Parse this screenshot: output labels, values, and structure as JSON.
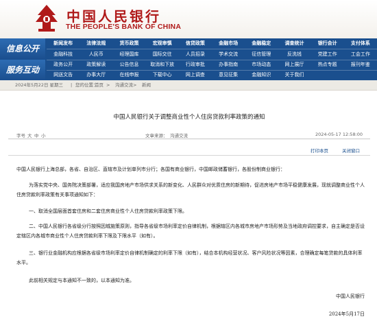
{
  "header": {
    "name_cn": "中国人民银行",
    "name_en": "THE PEOPLE'S BANK OF CHINA",
    "brand_color": "#b01a1a"
  },
  "nav": {
    "bg_color": "#1a4f8e",
    "label_1": "信息公开",
    "label_2": "服务互动",
    "row1": [
      "新闻发布",
      "法律法规",
      "货币政策",
      "宏观审慎",
      "信贷政策",
      "金融市场",
      "金融稳定",
      "调查统计",
      "银行会计",
      "支付体系"
    ],
    "row2": [
      "金融科技",
      "人民币",
      "经理国库",
      "国际交往",
      "人员招录",
      "学术交流",
      "征信管理",
      "反洗钱",
      "党建工作",
      "工会工作"
    ],
    "row3": [
      "政务公开",
      "政策解读",
      "公告信息",
      "取消和下放",
      "行政审批",
      "办事指南",
      "市场动态",
      "网上展厅",
      "热点专题",
      "报刊年鉴"
    ],
    "row4": [
      "网送文告",
      "办事大厅",
      "在线申报",
      "下载中心",
      "网上调查",
      "意见征集",
      "金融知识",
      "关于我们"
    ]
  },
  "breadcrumb": {
    "date": "2024年5月22日 星期三",
    "sep": "|",
    "path_label": "您的位置：",
    "home": "首页",
    "level1": "沟通交流",
    "level2": "新闻"
  },
  "article": {
    "title": "中国人民银行关于调整商业性个人住房贷款利率政策的通知",
    "font_size_label": "字号",
    "font_sizes": [
      "大",
      "中",
      "小"
    ],
    "source_label": "文章来源：",
    "source": "沟通交流",
    "datetime": "2024-05-17 12:58:00",
    "print_label": "打印本页",
    "close_label": "关闭窗口",
    "addressee": "中国人民银行上海总部，各省、自治区、直辖市及计划单列市分行；各国有商业银行，中国邮政储蓄银行，各股份制商业银行：",
    "intro": "为落实党中央、国务院决策部署，适应我国房地产市场供求关系的新变化、人民群众对优质住房的新期待，促进房地产市场平稳健康发展，现就调整商业性个人住房贷款利率政策有关事项通知如下：",
    "item1": "一、取消全国层面首套住房和二套住房商业性个人住房贷款利率政策下限。",
    "item2": "二、中国人民银行各省级分行按照因城施策原则，指导各省级市场利率定价自律机制，根据辖区内各城市房地产市场形势及当地政府调控要求，自主确定是否设定辖区内各城市商业性个人住房贷款利率下限及下限水平（如有）。",
    "item3": "三、银行业金融机构应根据各省级市场利率定价自律机制确定的利率下限（如有），结合本机构经营状况、客户风险状况等因素，合理确定每笔贷款的具体利率水平。",
    "closing": "此前相关规定与本通知不一致的，以本通知为准。",
    "signer": "中国人民银行",
    "sign_date": "2024年5月17日"
  }
}
